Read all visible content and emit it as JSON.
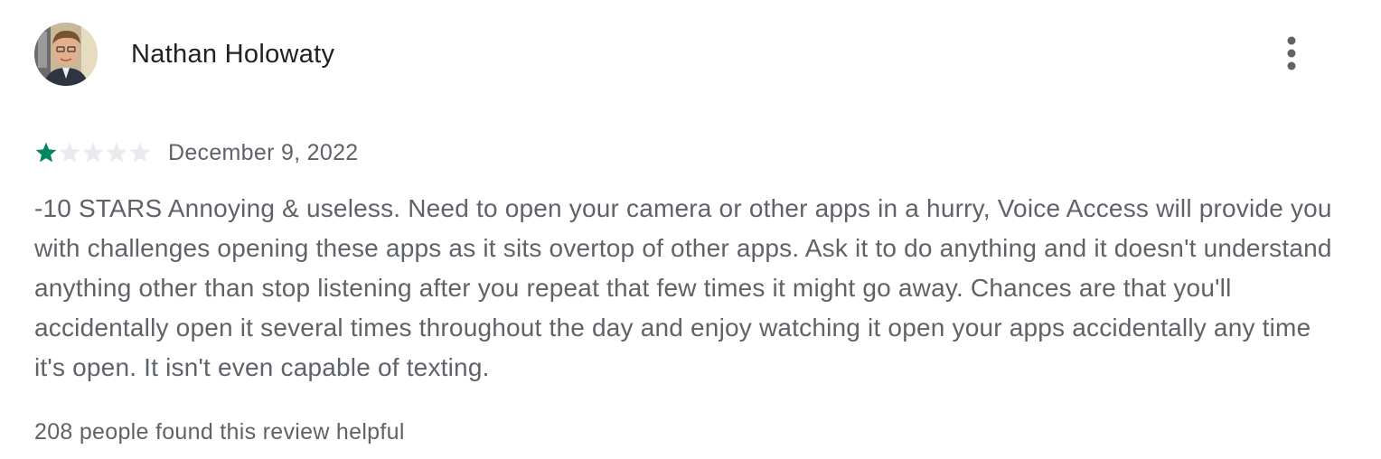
{
  "review": {
    "author": "Nathan Holowaty",
    "avatar_icon": "user-photo",
    "more_icon": "more-vert-icon",
    "rating": 1,
    "rating_max": 5,
    "star_filled_color": "#01875f",
    "star_empty_color": "#e8eaed",
    "date": "December 9, 2022",
    "text": "-10 STARS Annoying & useless. Need to open your camera or other apps in a hurry, Voice Access will provide you with challenges opening these apps as it sits overtop of other apps. Ask it to do anything and it doesn't understand anything other than stop listening after you repeat that few times it might go away. Chances are that you'll accidentally open it several times throughout the day and enjoy watching it open your apps accidentally any time it's open. It isn't even capable of texting.",
    "helpful_text": "208 people found this review helpful"
  }
}
